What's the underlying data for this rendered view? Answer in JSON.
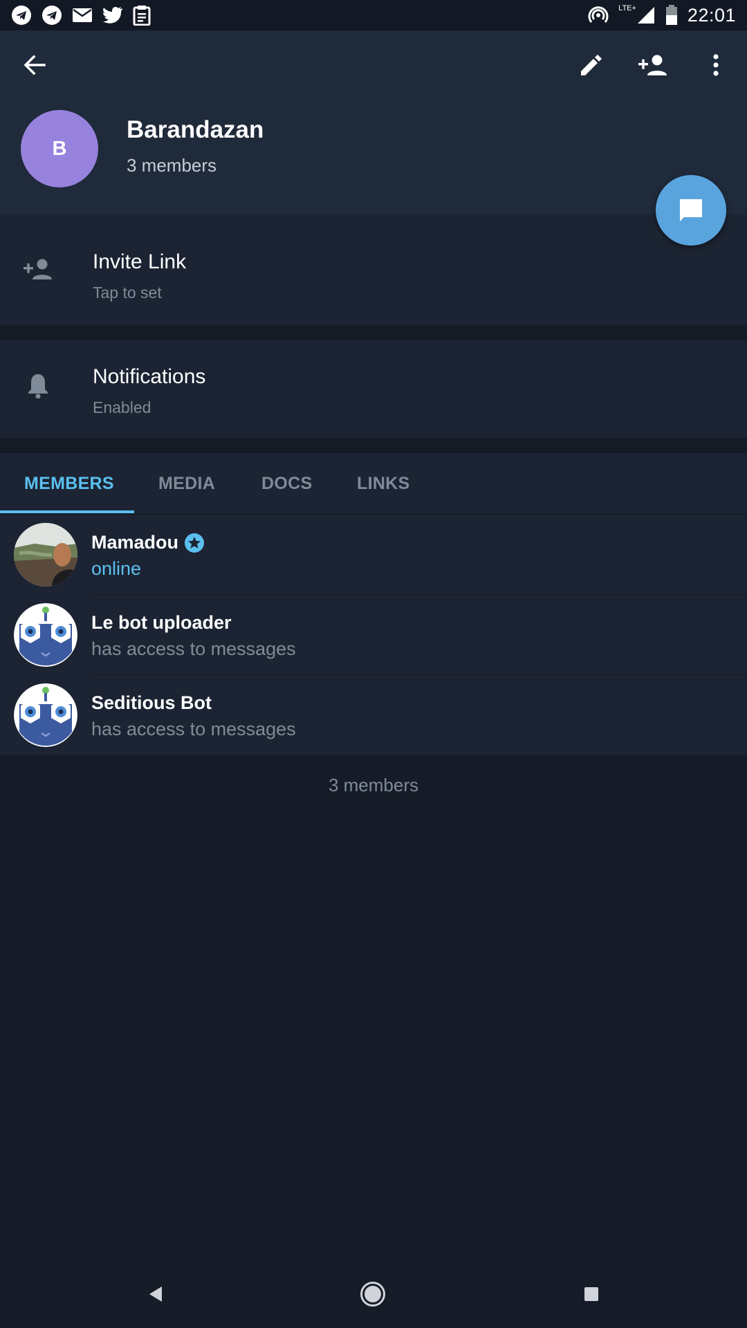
{
  "status_bar": {
    "time": "22:01",
    "network_label": "LTE+",
    "left_icons": [
      "telegram-icon",
      "telegram-icon",
      "mail-icon",
      "twitter-icon",
      "clipboard-icon"
    ],
    "right_icons": [
      "hotspot-icon",
      "signal-icon",
      "battery-icon"
    ]
  },
  "header": {
    "avatar_letter": "B",
    "avatar_color": "#9783dd",
    "title": "Barandazan",
    "subtitle": "3 members"
  },
  "settings": {
    "invite": {
      "title": "Invite Link",
      "subtitle": "Tap to set"
    },
    "notifications": {
      "title": "Notifications",
      "subtitle": "Enabled"
    }
  },
  "tabs": [
    {
      "label": "MEMBERS",
      "active": true
    },
    {
      "label": "MEDIA",
      "active": false
    },
    {
      "label": "DOCS",
      "active": false
    },
    {
      "label": "LINKS",
      "active": false
    }
  ],
  "members": [
    {
      "name": "Mamadou",
      "status": "online",
      "admin": true
    },
    {
      "name": "Le bot uploader",
      "status": "has access to messages",
      "admin": false
    },
    {
      "name": "Seditious Bot",
      "status": "has access to messages",
      "admin": false
    }
  ],
  "footer": {
    "count_text": "3 members"
  },
  "colors": {
    "accent": "#5bc0f0",
    "fab": "#5aa4de",
    "header_bg": "#1f2a3a",
    "page_bg": "#161c27"
  }
}
